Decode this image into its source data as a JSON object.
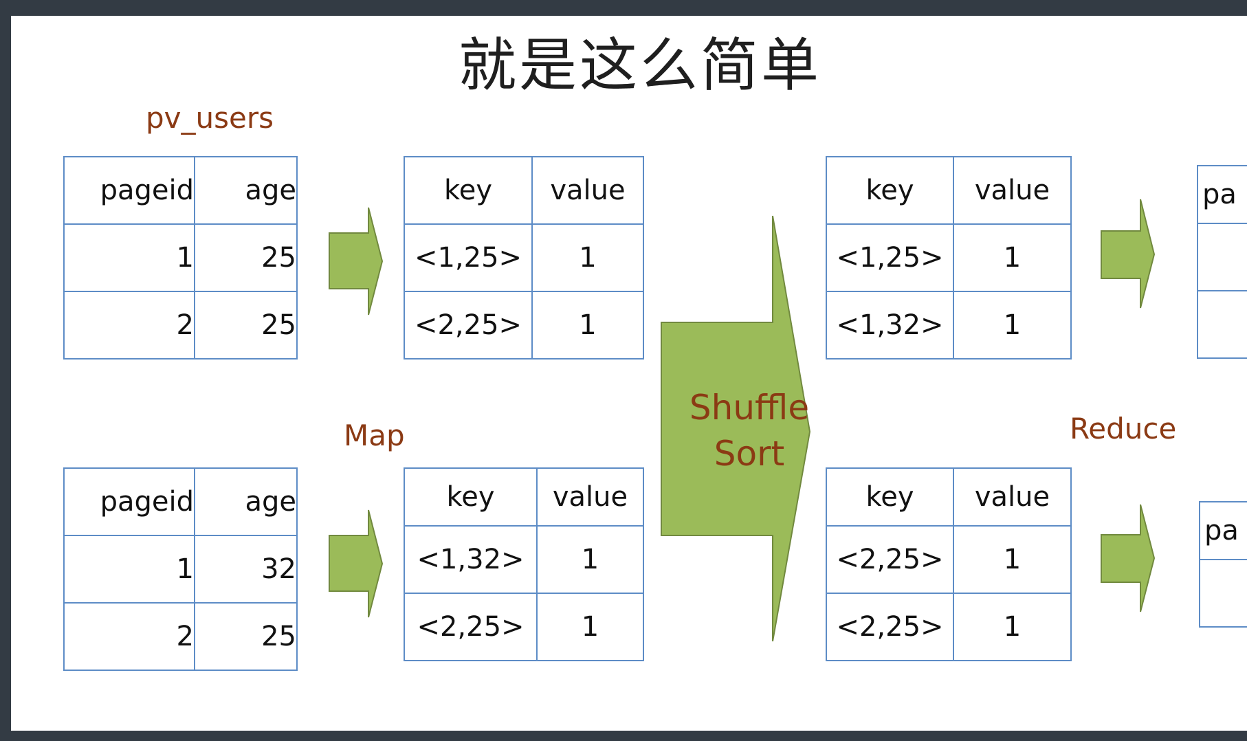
{
  "title": "就是这么简单",
  "labels": {
    "table_name": "pv_users",
    "map": "Map",
    "shuffle": "Shuffle",
    "sort": "Sort",
    "reduce": "Reduce"
  },
  "colors": {
    "arrow_fill": "#9bbb59",
    "arrow_stroke": "#71893f",
    "table_border": "#5d8cc6",
    "label": "#8b3a14"
  },
  "input_tables": [
    {
      "headers": [
        "pageid",
        "age"
      ],
      "rows": [
        [
          "1",
          "25"
        ],
        [
          "2",
          "25"
        ]
      ]
    },
    {
      "headers": [
        "pageid",
        "age"
      ],
      "rows": [
        [
          "1",
          "32"
        ],
        [
          "2",
          "25"
        ]
      ]
    }
  ],
  "map_tables": [
    {
      "headers": [
        "key",
        "value"
      ],
      "rows": [
        [
          "<1,25>",
          "1"
        ],
        [
          "<2,25>",
          "1"
        ]
      ]
    },
    {
      "headers": [
        "key",
        "value"
      ],
      "rows": [
        [
          "<1,32>",
          "1"
        ],
        [
          "<2,25>",
          "1"
        ]
      ]
    }
  ],
  "shuffle_tables": [
    {
      "headers": [
        "key",
        "value"
      ],
      "rows": [
        [
          "<1,25>",
          "1"
        ],
        [
          "<1,32>",
          "1"
        ]
      ]
    },
    {
      "headers": [
        "key",
        "value"
      ],
      "rows": [
        [
          "<2,25>",
          "1"
        ],
        [
          "<2,25>",
          "1"
        ]
      ]
    }
  ],
  "reduce_tables": [
    {
      "headers": [
        "pa"
      ]
    },
    {
      "headers": [
        "pa"
      ]
    }
  ]
}
